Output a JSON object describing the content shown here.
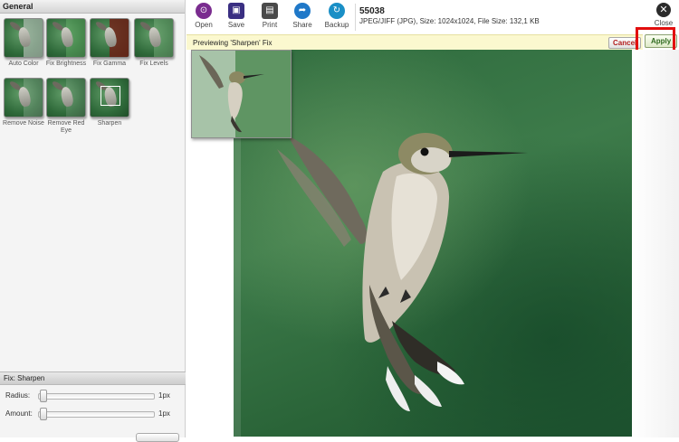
{
  "left_panel": {
    "header": "General",
    "fixes": [
      {
        "label": "Auto Color"
      },
      {
        "label": "Fix Brightness"
      },
      {
        "label": "Fix Gamma"
      },
      {
        "label": "Fix Levels"
      },
      {
        "label": "Remove Noise"
      },
      {
        "label": "Remove Red Eye"
      },
      {
        "label": "Sharpen"
      }
    ],
    "fix_panel": {
      "header": "Fix: Sharpen",
      "radius_label": "Radius:",
      "radius_value": "1px",
      "amount_label": "Amount:",
      "amount_value": "1px"
    }
  },
  "toolbar": {
    "tools": [
      {
        "label": "Open",
        "icon": "open-icon",
        "color": "#7a2c8f"
      },
      {
        "label": "Save",
        "icon": "save-icon",
        "color": "#3a2f82"
      },
      {
        "label": "Print",
        "icon": "print-icon",
        "color": "#4a4a4a"
      },
      {
        "label": "Share",
        "icon": "share-icon",
        "color": "#1f78c8"
      },
      {
        "label": "Backup",
        "icon": "backup-icon",
        "color": "#1a8fc6"
      }
    ],
    "close_label": "Close",
    "file": {
      "name": "55038",
      "meta": "JPEG/JIFF (JPG), Size: 1024x1024, File Size: 132,1 KB"
    }
  },
  "preview_bar": {
    "message": "Previewing 'Sharpen' Fix",
    "cancel_label": "Cancel",
    "apply_label": "Apply"
  },
  "colors": {
    "accent_highlight": "#e20e0e",
    "preview_bar_bg": "#fbf8cf",
    "photo_bg": "#2e6a3d"
  }
}
